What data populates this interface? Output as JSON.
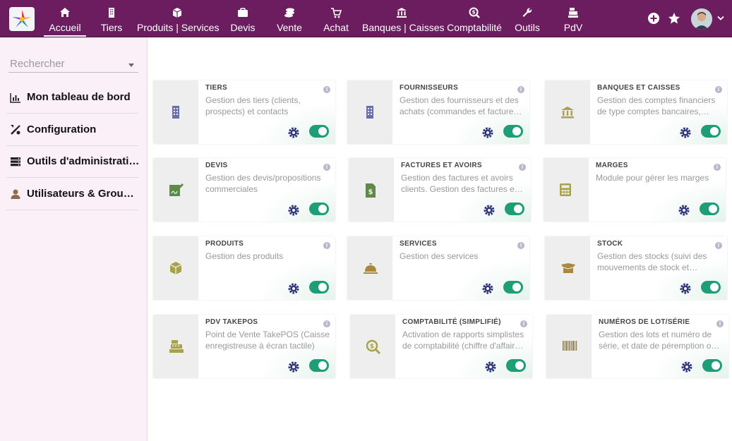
{
  "topnav": {
    "items": [
      {
        "label": "Accueil",
        "icon": "home-icon"
      },
      {
        "label": "Tiers",
        "icon": "building-icon"
      },
      {
        "label": "Produits | Services",
        "icon": "cube-icon"
      },
      {
        "label": "Devis",
        "icon": "briefcase-icon"
      },
      {
        "label": "Vente",
        "icon": "coins-icon"
      },
      {
        "label": "Achat",
        "icon": "cart-icon"
      },
      {
        "label": "Banques | Caisses",
        "icon": "bank-icon"
      },
      {
        "label": "Comptabilité",
        "icon": "search-dollar-icon"
      },
      {
        "label": "Outils",
        "icon": "wrench-icon"
      },
      {
        "label": "PdV",
        "icon": "cash-register-icon"
      }
    ],
    "active": "Accueil"
  },
  "sidebar": {
    "search_placeholder": "Rechercher",
    "items": [
      {
        "label": "Mon tableau de bord",
        "icon": "chart-icon"
      },
      {
        "label": "Configuration",
        "icon": "tools-icon"
      },
      {
        "label": "Outils d'administration",
        "icon": "server-icon"
      },
      {
        "label": "Utilisateurs & Groupes",
        "icon": "user-icon"
      }
    ]
  },
  "modules": [
    {
      "title": "TIERS",
      "desc": "Gestion des tiers (clients, prospects) et contacts",
      "icon": "building-icon",
      "enabled": true
    },
    {
      "title": "FOURNISSEURS",
      "desc": "Gestion des fournisseurs et des achats (commandes et factures fournisseurs)",
      "icon": "building-icon",
      "enabled": true
    },
    {
      "title": "BANQUES ET CAISSES",
      "desc": "Gestion des comptes financiers de type comptes bancaires, postaux ou caisses",
      "icon": "bank-icon",
      "enabled": true
    },
    {
      "title": "DEVIS",
      "desc": "Gestion des devis/propositions commerciales",
      "icon": "signature-icon",
      "enabled": true
    },
    {
      "title": "FACTURES ET AVOIRS",
      "desc": "Gestion des factures et avoirs clients. Gestion des factures et avoirs fournisseurs",
      "icon": "invoice-icon",
      "enabled": true
    },
    {
      "title": "MARGES",
      "desc": "Module pour gérer les marges",
      "icon": "calculator-icon",
      "enabled": true
    },
    {
      "title": "PRODUITS",
      "desc": "Gestion des produits",
      "icon": "cube-icon",
      "enabled": true
    },
    {
      "title": "SERVICES",
      "desc": "Gestion des services",
      "icon": "bell-service-icon",
      "enabled": true
    },
    {
      "title": "STOCK",
      "desc": "Gestion des stocks (suivi des mouvements de stock et inventaire)",
      "icon": "box-open-icon",
      "enabled": true
    },
    {
      "title": "PDV TAKEPOS",
      "desc": "Point de Vente TakePOS (Caisse enregistreuse à écran tactile)",
      "icon": "cash-register-icon",
      "enabled": true
    },
    {
      "title": "COMPTABILITÉ (SIMPLIFIÉ)",
      "desc": "Activation de rapports simplistes de comptabilité (chiffre d'affaires, bénéfices)",
      "icon": "search-dollar-icon",
      "enabled": true
    },
    {
      "title": "NUMÉROS DE LOT/SÉRIE",
      "desc": "Gestion des lots et numéro de série, et date de péremption ou limite de consommation",
      "icon": "barcode-icon",
      "enabled": true
    }
  ],
  "colors": {
    "topbar": "#6b1d5f",
    "toggle_on": "#1e9e77",
    "gear": "#1a1a6e",
    "sidebar_bg": "#fbf0f7"
  }
}
